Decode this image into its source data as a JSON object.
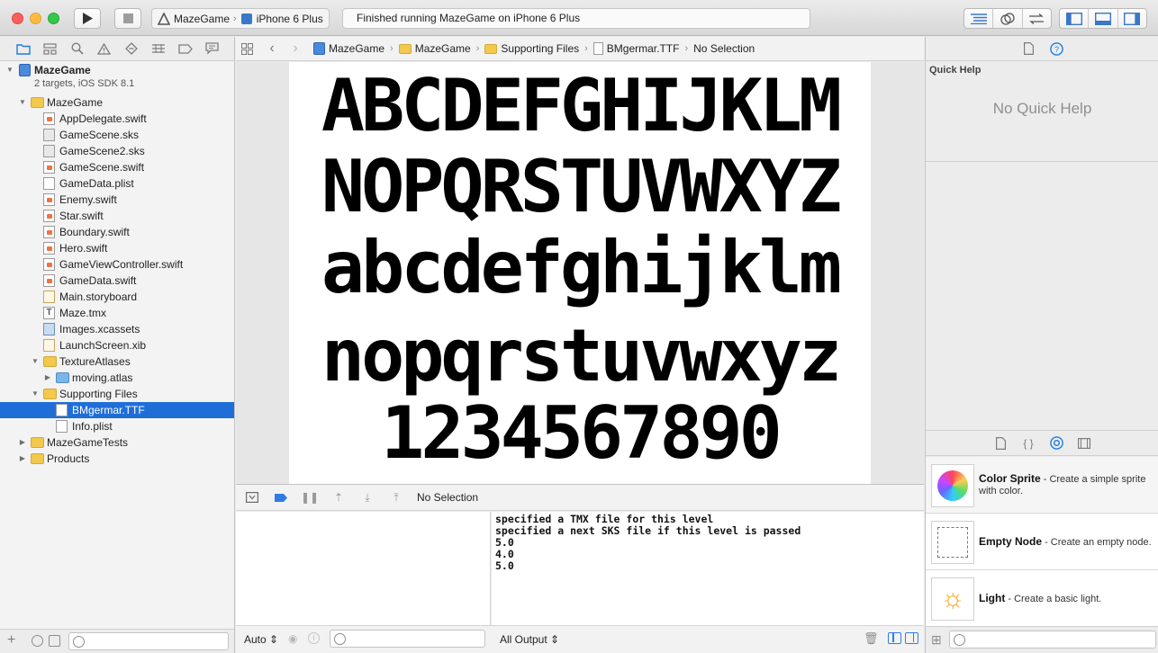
{
  "toolbar": {
    "scheme_name": "MazeGame",
    "device": "iPhone 6 Plus",
    "activity": "Finished running MazeGame on iPhone 6 Plus"
  },
  "navigator": {
    "project": {
      "name": "MazeGame",
      "subtitle": "2 targets, iOS SDK 8.1"
    },
    "items": [
      {
        "label": "MazeGame",
        "type": "folder",
        "level": 1,
        "open": true
      },
      {
        "label": "AppDelegate.swift",
        "type": "swift",
        "level": 2
      },
      {
        "label": "GameScene.sks",
        "type": "sks",
        "level": 2
      },
      {
        "label": "GameScene2.sks",
        "type": "sks",
        "level": 2
      },
      {
        "label": "GameScene.swift",
        "type": "swift",
        "level": 2
      },
      {
        "label": "GameData.plist",
        "type": "file",
        "level": 2
      },
      {
        "label": "Enemy.swift",
        "type": "swift",
        "level": 2
      },
      {
        "label": "Star.swift",
        "type": "swift",
        "level": 2
      },
      {
        "label": "Boundary.swift",
        "type": "swift",
        "level": 2
      },
      {
        "label": "Hero.swift",
        "type": "swift",
        "level": 2
      },
      {
        "label": "GameViewController.swift",
        "type": "swift",
        "level": 2
      },
      {
        "label": "GameData.swift",
        "type": "swift",
        "level": 2
      },
      {
        "label": "Main.storyboard",
        "type": "xib",
        "level": 2
      },
      {
        "label": "Maze.tmx",
        "type": "tmx",
        "level": 2
      },
      {
        "label": "Images.xcassets",
        "type": "xcassets",
        "level": 2
      },
      {
        "label": "LaunchScreen.xib",
        "type": "xib",
        "level": 2
      },
      {
        "label": "TextureAtlases",
        "type": "folder",
        "level": 2,
        "open": true
      },
      {
        "label": "moving.atlas",
        "type": "atlas",
        "level": 3,
        "open": false
      },
      {
        "label": "Supporting Files",
        "type": "folder",
        "level": 2,
        "open": true
      },
      {
        "label": "BMgermar.TTF",
        "type": "file",
        "level": 3,
        "selected": true
      },
      {
        "label": "Info.plist",
        "type": "file",
        "level": 3
      },
      {
        "label": "MazeGameTests",
        "type": "folder",
        "level": 1,
        "open": false
      },
      {
        "label": "Products",
        "type": "folder",
        "level": 1,
        "open": false
      }
    ]
  },
  "jumpbar": {
    "crumbs": [
      "MazeGame",
      "MazeGame",
      "Supporting Files",
      "BMgermar.TTF",
      "No Selection"
    ]
  },
  "font_preview": {
    "lines": [
      "ABCDEFGHIJKLM",
      "NOPQRSTUVWXYZ",
      "abcdefghijklm",
      "nopqrstuvwxyz",
      "1234567890"
    ]
  },
  "debug": {
    "selection": "No Selection",
    "console_lines": [
      "specified a TMX file for this level",
      "specified a next SKS file if this level is passed",
      "5.0",
      "4.0",
      "5.0"
    ],
    "variables_mode": "Auto ⇕",
    "output_mode": "All Output ⇕"
  },
  "inspector": {
    "quick_help_title": "Quick Help",
    "quick_help_empty": "No Quick Help",
    "library": [
      {
        "name": "Color Sprite",
        "desc": " - Create a simple sprite with color."
      },
      {
        "name": "Empty Node",
        "desc": " - Create an empty node."
      },
      {
        "name": "Light",
        "desc": " - Create a basic light."
      }
    ]
  },
  "colors": {
    "selection": "#1f6ed8",
    "accent": "#1d7ce3",
    "folder": "#f2c94c"
  }
}
